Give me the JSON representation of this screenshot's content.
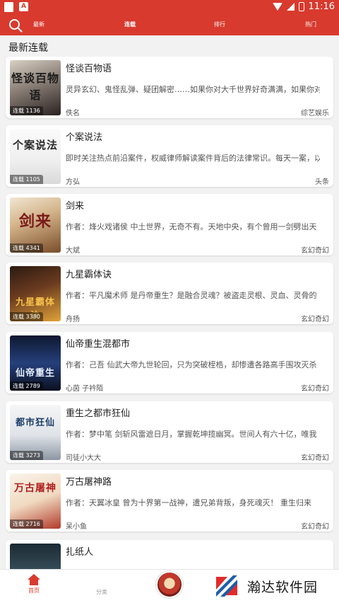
{
  "status_bar": {
    "time": "11:16"
  },
  "nav": {
    "tabs": [
      {
        "label": "最新"
      },
      {
        "label": "连载"
      },
      {
        "label": "排行"
      },
      {
        "label": "热门"
      }
    ]
  },
  "section_title": "最新连载",
  "books": [
    {
      "title": "怪谈百物语",
      "desc": "灵异玄幻、鬼怪乱弹、疑团解密……如果你对大千世界好奇满满，如果你对",
      "author": "佚名",
      "genre": "综艺娱乐",
      "badge": "连载 1136",
      "cover_text": "怪谈百物语"
    },
    {
      "title": "个案说法",
      "desc": "即时关注热点前沿案件，权威律师解读案件背后的法律常识。每天一案，以",
      "author": "方弘",
      "genre": "头条",
      "badge": "连载 1105",
      "cover_text": "个案说法"
    },
    {
      "title": "剑来",
      "desc": "作者：烽火戏诸侯 中土世界，无奇不有。天地中央，有个曾用一剑劈出天",
      "author": "大斌",
      "genre": "玄幻奇幻",
      "badge": "连载 4341",
      "cover_text": "剑来"
    },
    {
      "title": "九星霸体诀",
      "desc": "作者：平凡魔术师 是丹帝重生？是融合灵魂？被盗走灵根、灵血、灵骨的",
      "author": "舟扬",
      "genre": "玄幻奇幻",
      "badge": "连载 3380",
      "cover_text": "九星霸体诀"
    },
    {
      "title": "仙帝重生混都市",
      "desc": "作者：己吾 仙武大帝九世轮回，只为突破桎梏，却惨遭各路高手围攻灭杀",
      "author": "心茵 子衿陌",
      "genre": "玄幻奇幻",
      "badge": "连载 2789",
      "cover_text": "仙帝重生"
    },
    {
      "title": "重生之都市狂仙",
      "desc": "作者：梦中笔 剑斩风雷遮日月，掌握乾坤揽幽冥。世间人有六十亿，唯我",
      "author": "司徒小大大",
      "genre": "玄幻奇幻",
      "badge": "连载 3273",
      "cover_text": "都市狂仙"
    },
    {
      "title": "万古屠神路",
      "desc": "作者：天翼冰皇 曾为十界第一战神，遭兄弟背叛，身死魂灭！ 重生归来",
      "author": "呆小鱼",
      "genre": "玄幻奇幻",
      "badge": "连载 2716",
      "cover_text": "万古屠神"
    },
    {
      "title": "扎纸人",
      "desc": "",
      "author": "",
      "genre": "",
      "badge": "",
      "cover_text": ""
    }
  ],
  "bottom_nav": {
    "items": [
      {
        "label": "首页"
      },
      {
        "label": "分类"
      }
    ]
  },
  "watermark": {
    "text": "瀚达软件园"
  },
  "colors": {
    "brand": "#d83a2e",
    "text": "#222222",
    "subtext": "#555555"
  }
}
